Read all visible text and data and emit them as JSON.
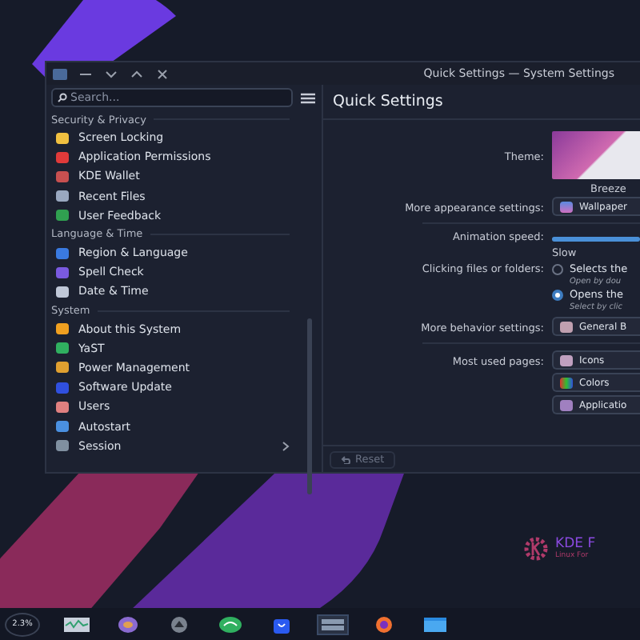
{
  "window": {
    "title": "Quick Settings — System Settings"
  },
  "sidebar": {
    "search": {
      "placeholder": "Search..."
    },
    "groups": [
      {
        "title": "Security & Privacy",
        "items": [
          {
            "label": "Screen Locking",
            "selected": false
          },
          {
            "label": "Application Permissions",
            "selected": false
          },
          {
            "label": "KDE Wallet",
            "selected": false
          },
          {
            "label": "Recent Files",
            "selected": false
          },
          {
            "label": "User Feedback",
            "selected": false
          }
        ]
      },
      {
        "title": "Language & Time",
        "items": [
          {
            "label": "Region & Language",
            "selected": false
          },
          {
            "label": "Spell Check",
            "selected": false
          },
          {
            "label": "Date & Time",
            "selected": false
          }
        ]
      },
      {
        "title": "System",
        "items": [
          {
            "label": "About this System",
            "selected": false
          },
          {
            "label": "YaST",
            "selected": false
          },
          {
            "label": "Power Management",
            "selected": false
          },
          {
            "label": "Software Update",
            "selected": false
          },
          {
            "label": "Users",
            "selected": false
          },
          {
            "label": "Autostart",
            "selected": false
          },
          {
            "label": "Session",
            "selected": false,
            "expandable": true
          }
        ]
      }
    ]
  },
  "content": {
    "title": "Quick Settings",
    "theme": {
      "label": "Theme:",
      "name": "Breeze"
    },
    "appearance": {
      "label": "More appearance settings:",
      "button": "Wallpaper"
    },
    "animation": {
      "label": "Animation speed:",
      "min_label": "Slow",
      "level": 1
    },
    "clicking": {
      "label": "Clicking files or folders:",
      "options": [
        {
          "label": "Selects the",
          "hint": "Open by dou",
          "selected": false
        },
        {
          "label": "Opens the",
          "hint": "Select by clic",
          "selected": true
        }
      ]
    },
    "behavior": {
      "label": "More behavior settings:",
      "button": "General B"
    },
    "most_used": {
      "label": "Most used pages:",
      "pages": [
        "Icons",
        "Colors",
        "Applicatio"
      ]
    },
    "reset": "Reset"
  },
  "wallpaper_logo": {
    "title": "KDE F",
    "subtitle": "Linux For"
  },
  "taskbar": {
    "cpu": "2.3%"
  }
}
